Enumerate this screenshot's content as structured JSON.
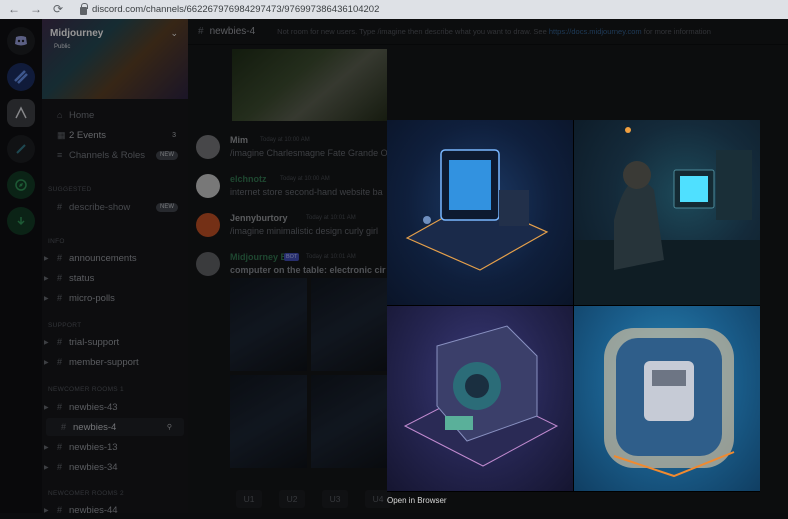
{
  "browser": {
    "url": "discord.com/channels/662267976984297473/976997386436104202",
    "back_icon": "←",
    "forward_icon": "→",
    "reload_icon": "⟳"
  },
  "server": {
    "name": "Midjourney",
    "sub": "Public",
    "chevron": "⌄"
  },
  "sidebar": {
    "items_top": [
      {
        "label": "Home"
      },
      {
        "label": "2 Events",
        "count": "3"
      },
      {
        "label": "Channels & Roles",
        "badge": "NEW"
      }
    ],
    "suggested_header": "SUGGESTED",
    "suggested": [
      {
        "label": "describe-show",
        "badge": "NEW"
      }
    ],
    "info_header": "INFO",
    "info": [
      {
        "label": "announcements"
      },
      {
        "label": "status"
      },
      {
        "label": "micro-polls"
      }
    ],
    "support_header": "SUPPORT",
    "support": [
      {
        "label": "trial-support"
      },
      {
        "label": "member-support"
      }
    ],
    "newcomer_header": "NEWCOMER ROOMS 1",
    "newcomer": [
      {
        "label": "newbies-43"
      },
      {
        "label": "newbies-4"
      },
      {
        "label": "newbies-13"
      },
      {
        "label": "newbies-34"
      }
    ],
    "newcomer2_header": "NEWCOMER ROOMS 2",
    "newcomer2": [
      {
        "label": "newbies-44"
      }
    ]
  },
  "channel": {
    "name": "newbies-4",
    "topic": "Not room for new users. Type /imagine then describe what you want to draw. See",
    "topic_link": "https://docs.midjourney.com",
    "topic_end": "for more information"
  },
  "messages": [
    {
      "author": "Mim",
      "time": "Today at 10:00 AM",
      "text": "/imagine Charlesmagne Fate Grande O"
    },
    {
      "author": "elchnotz",
      "time": "Today at 10:00 AM",
      "text": "internet store second-hand website ba"
    },
    {
      "author": "Jennyburtory",
      "time": "Today at 10:01 AM",
      "text": "/imagine minimalistic design curly girl"
    },
    {
      "author": "Midjourney Bot",
      "tag": "BOT",
      "time": "Today at 10:01 AM",
      "text": "computer on the table: electronic cir"
    }
  ],
  "upscale_buttons": [
    "U1",
    "U2",
    "U3",
    "U4"
  ],
  "viewer": {
    "open_label": "Open in Browser"
  },
  "colors": {
    "accent": "#5865f2",
    "link": "#00a8fc",
    "online": "#23a55a"
  }
}
